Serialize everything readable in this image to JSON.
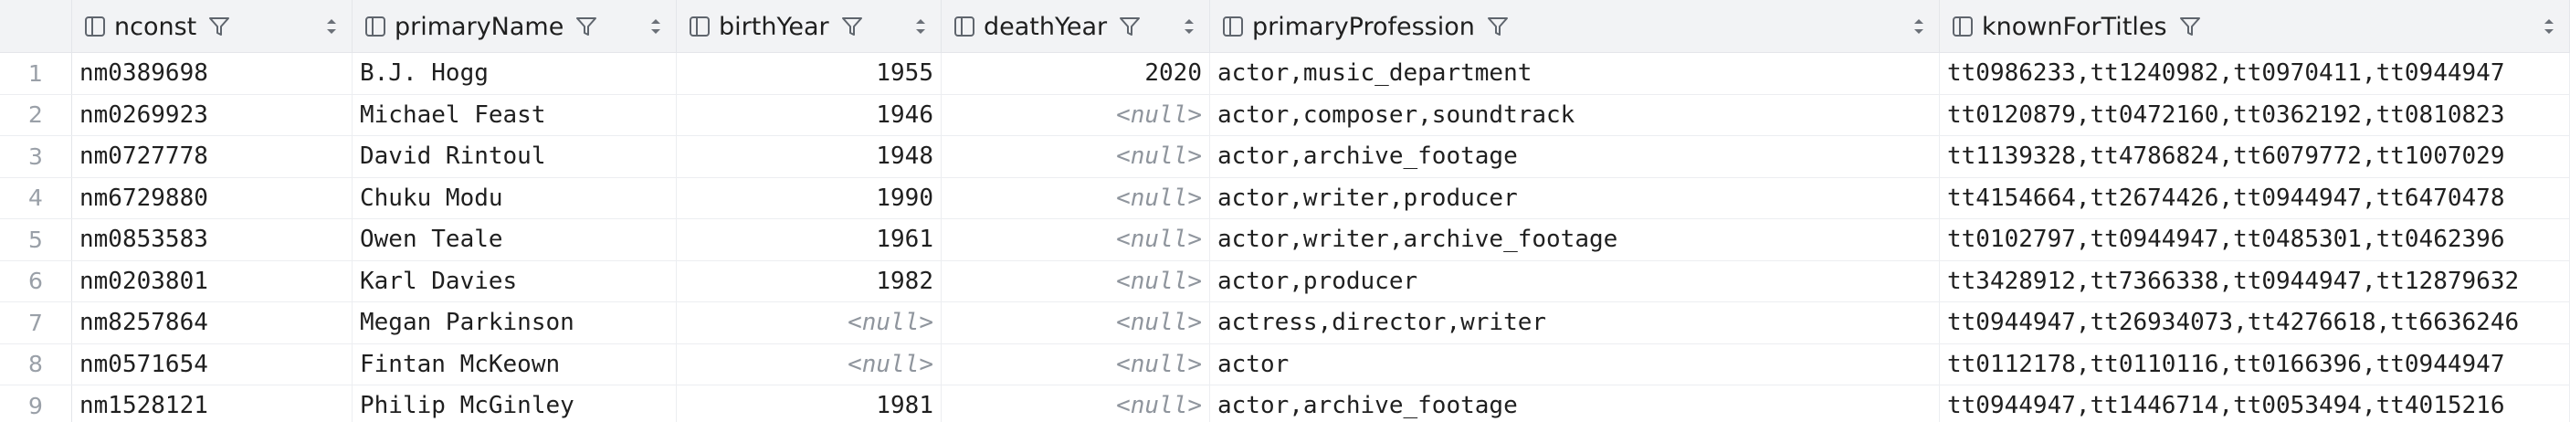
{
  "columns": [
    {
      "key": "nconst",
      "label": "nconst",
      "align": "left"
    },
    {
      "key": "primaryName",
      "label": "primaryName",
      "align": "left"
    },
    {
      "key": "birthYear",
      "label": "birthYear",
      "align": "right"
    },
    {
      "key": "deathYear",
      "label": "deathYear",
      "align": "right"
    },
    {
      "key": "primaryProfession",
      "label": "primaryProfession",
      "align": "left"
    },
    {
      "key": "knownForTitles",
      "label": "knownForTitles",
      "align": "left"
    }
  ],
  "null_label": "<null>",
  "rows": [
    {
      "num": "1",
      "nconst": "nm0389698",
      "primaryName": "B.J. Hogg",
      "birthYear": "1955",
      "deathYear": "2020",
      "primaryProfession": "actor,music_department",
      "knownForTitles": "tt0986233,tt1240982,tt0970411,tt0944947"
    },
    {
      "num": "2",
      "nconst": "nm0269923",
      "primaryName": "Michael Feast",
      "birthYear": "1946",
      "deathYear": null,
      "primaryProfession": "actor,composer,soundtrack",
      "knownForTitles": "tt0120879,tt0472160,tt0362192,tt0810823"
    },
    {
      "num": "3",
      "nconst": "nm0727778",
      "primaryName": "David Rintoul",
      "birthYear": "1948",
      "deathYear": null,
      "primaryProfession": "actor,archive_footage",
      "knownForTitles": "tt1139328,tt4786824,tt6079772,tt1007029"
    },
    {
      "num": "4",
      "nconst": "nm6729880",
      "primaryName": "Chuku Modu",
      "birthYear": "1990",
      "deathYear": null,
      "primaryProfession": "actor,writer,producer",
      "knownForTitles": "tt4154664,tt2674426,tt0944947,tt6470478"
    },
    {
      "num": "5",
      "nconst": "nm0853583",
      "primaryName": "Owen Teale",
      "birthYear": "1961",
      "deathYear": null,
      "primaryProfession": "actor,writer,archive_footage",
      "knownForTitles": "tt0102797,tt0944947,tt0485301,tt0462396"
    },
    {
      "num": "6",
      "nconst": "nm0203801",
      "primaryName": "Karl Davies",
      "birthYear": "1982",
      "deathYear": null,
      "primaryProfession": "actor,producer",
      "knownForTitles": "tt3428912,tt7366338,tt0944947,tt12879632"
    },
    {
      "num": "7",
      "nconst": "nm8257864",
      "primaryName": "Megan Parkinson",
      "birthYear": null,
      "deathYear": null,
      "primaryProfession": "actress,director,writer",
      "knownForTitles": "tt0944947,tt26934073,tt4276618,tt6636246"
    },
    {
      "num": "8",
      "nconst": "nm0571654",
      "primaryName": "Fintan McKeown",
      "birthYear": null,
      "deathYear": null,
      "primaryProfession": "actor",
      "knownForTitles": "tt0112178,tt0110116,tt0166396,tt0944947"
    },
    {
      "num": "9",
      "nconst": "nm1528121",
      "primaryName": "Philip McGinley",
      "birthYear": "1981",
      "deathYear": null,
      "primaryProfession": "actor,archive_footage",
      "knownForTitles": "tt0944947,tt1446714,tt0053494,tt4015216"
    }
  ]
}
